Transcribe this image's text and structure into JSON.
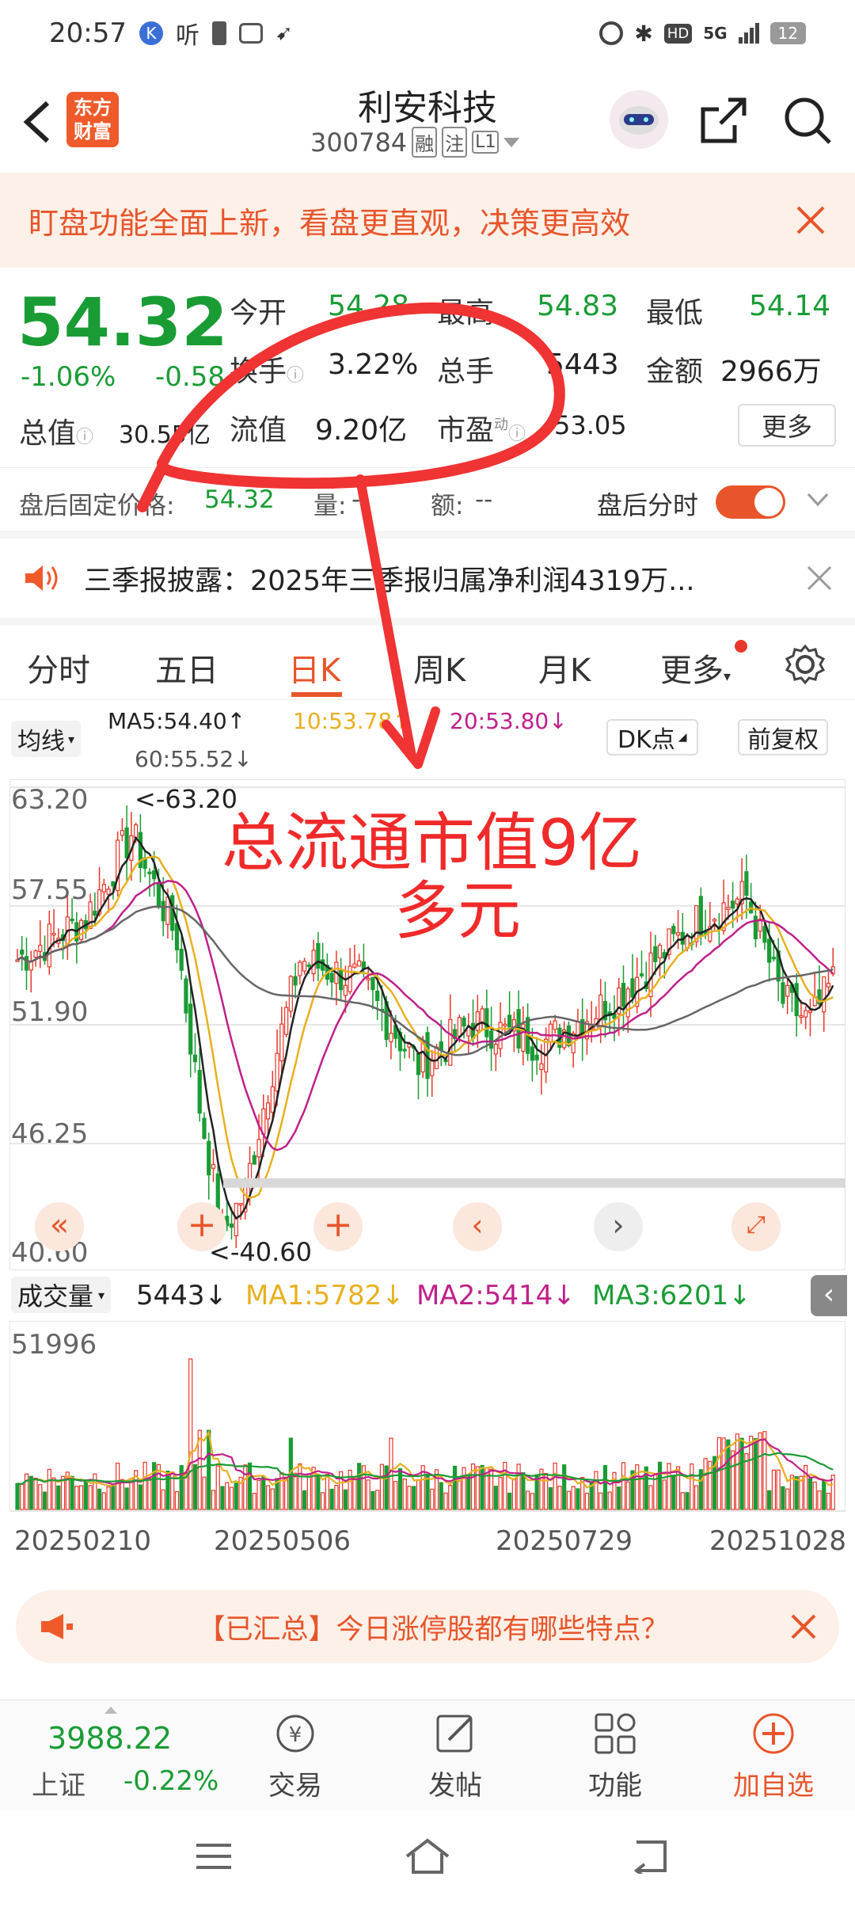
{
  "status_bar": {
    "time": "20:57",
    "left_icons": [
      "k-app-icon",
      "ting-icon",
      "battery-saver-icon",
      "game-icon",
      "paper-plane-icon"
    ],
    "listen_label": "听",
    "network": "5G",
    "battery": "12"
  },
  "header": {
    "logo_top": "东方",
    "logo_bottom": "财富",
    "title": "利安科技",
    "code": "300784",
    "tag1": "融",
    "tag2": "注",
    "tag3": "L1"
  },
  "banner": {
    "text": "盯盘功能全面上新，看盘更直观，决策更高效"
  },
  "quote": {
    "price": "54.32",
    "change_pct": "-1.06%",
    "change_abs": "-0.58",
    "fields": [
      {
        "label": "今开",
        "value": "54.28",
        "color": "green"
      },
      {
        "label": "最高",
        "value": "54.83",
        "color": "green"
      },
      {
        "label": "最低",
        "value": "54.14",
        "color": "green"
      },
      {
        "label": "换手",
        "value": "3.22%",
        "color": "dark"
      },
      {
        "label": "总手",
        "value": "5443",
        "color": "dark"
      },
      {
        "label": "金额",
        "value": "2966万",
        "color": "dark"
      },
      {
        "label": "总值",
        "value": "30.55亿",
        "color": "dark"
      },
      {
        "label": "流值",
        "value": "9.20亿",
        "color": "dark"
      },
      {
        "label": "市盈",
        "value": "53.05",
        "color": "dark"
      }
    ],
    "pe_sup": "动",
    "more_button": "更多"
  },
  "after_hours": {
    "label": "盘后固定价格:",
    "price": "54.32",
    "vol_label": "量:",
    "vol": "--",
    "amt_label": "额:",
    "amt": "--",
    "toggle_label": "盘后分时",
    "toggle_on": true
  },
  "news": {
    "text": "三季报披露：2025年三季报归属净利润4319万..."
  },
  "tabs": {
    "items": [
      "分时",
      "五日",
      "日K",
      "周K",
      "月K",
      "更多"
    ],
    "active": 2
  },
  "ma_bar": {
    "select": "均线",
    "ma5": "MA5:54.40↑",
    "ma10": "10:53.78↑",
    "ma20": "20:53.80↓",
    "ma60": "60:55.52↓",
    "dk": "DK点",
    "adj": "前复权"
  },
  "kline": {
    "y_labels": [
      "63.20",
      "57.55",
      "51.90",
      "46.25",
      "40.60"
    ],
    "max_mark": "<-63.20",
    "min_mark": "<-40.60",
    "ylim": [
      40.6,
      63.2
    ]
  },
  "annotation": {
    "line1": "总流通市值9亿",
    "line2": "多元"
  },
  "volume_bar": {
    "select": "成交量",
    "vol": "5443↓",
    "ma1": "MA1:5782↓",
    "ma2": "MA2:5414↓",
    "ma3": "MA3:6201↓"
  },
  "volume": {
    "top_label": "51996",
    "dates": [
      "20250210",
      "20250506",
      "20250729",
      "20251028"
    ]
  },
  "promo": {
    "text": "【已汇总】今日涨停股都有哪些特点？"
  },
  "bottom_nav": {
    "index_value": "3988.22",
    "index_name": "上证",
    "index_change": "-0.22%",
    "items": [
      "交易",
      "发帖",
      "功能",
      "加自选"
    ]
  },
  "colors": {
    "up": "#e8372b",
    "down": "#1a9c35",
    "accent": "#ff6a00",
    "ma5": "#222222",
    "ma10": "#e8b020",
    "ma20": "#c0208a",
    "ma60": "#666666"
  }
}
